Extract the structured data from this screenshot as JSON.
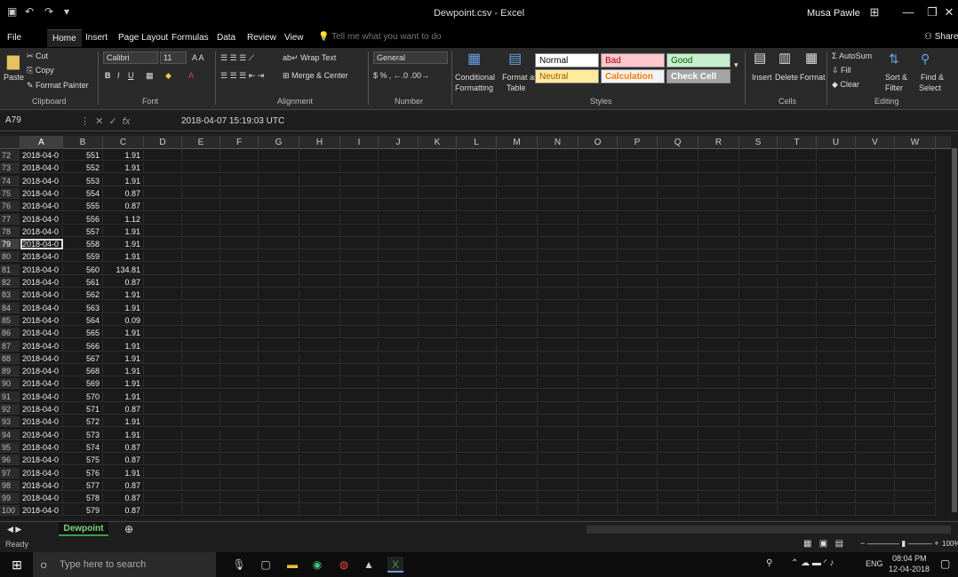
{
  "window": {
    "title": "Dewpoint.csv - Excel",
    "user": "Musa Pawle"
  },
  "tabs": [
    "File",
    "Home",
    "Insert",
    "Page Layout",
    "Formulas",
    "Data",
    "Review",
    "View"
  ],
  "tell_me": "Tell me what you want to do",
  "share": "Share",
  "ribbon": {
    "clipboard": {
      "paste": "Paste",
      "cut": "Cut",
      "copy": "Copy",
      "format_painter": "Format Painter",
      "label": "Clipboard"
    },
    "font": {
      "name": "Calibri",
      "size": "11",
      "label": "Font"
    },
    "alignment": {
      "wrap_text": "Wrap Text",
      "merge_center": "Merge & Center",
      "label": "Alignment"
    },
    "number": {
      "format": "General",
      "label": "Number"
    },
    "styles": {
      "conditional": "Conditional",
      "formatting": "Formatting",
      "format_as": "Format as",
      "table": "Table",
      "normal": "Normal",
      "bad": "Bad",
      "good": "Good",
      "neutral": "Neutral",
      "calculation": "Calculation",
      "check_cell": "Check Cell",
      "label": "Styles"
    },
    "cells": {
      "insert": "Insert",
      "delete": "Delete",
      "format": "Format",
      "label": "Cells"
    },
    "editing": {
      "autosum": "AutoSum",
      "fill": "Fill",
      "clear": "Clear",
      "sort_filter": "Sort &",
      "filter": "Filter",
      "find_select": "Find &",
      "select": "Select",
      "label": "Editing"
    }
  },
  "formula_bar": {
    "name_box": "A79",
    "value": "2018-04-07 15:19:03 UTC"
  },
  "columns": [
    "A",
    "B",
    "C",
    "D",
    "E",
    "F",
    "G",
    "H",
    "I",
    "J",
    "K",
    "L",
    "M",
    "N",
    "O",
    "P",
    "Q",
    "R",
    "S",
    "T",
    "U",
    "V",
    "W"
  ],
  "selected_cell": {
    "row": 79,
    "col": "A"
  },
  "rows": [
    {
      "n": 72,
      "a": "2018-04-0",
      "b": "551",
      "c": "1.91"
    },
    {
      "n": 73,
      "a": "2018-04-0",
      "b": "552",
      "c": "1.91"
    },
    {
      "n": 74,
      "a": "2018-04-0",
      "b": "553",
      "c": "1.91"
    },
    {
      "n": 75,
      "a": "2018-04-0",
      "b": "554",
      "c": "0.87"
    },
    {
      "n": 76,
      "a": "2018-04-0",
      "b": "555",
      "c": "0.87"
    },
    {
      "n": 77,
      "a": "2018-04-0",
      "b": "556",
      "c": "1.12"
    },
    {
      "n": 78,
      "a": "2018-04-0",
      "b": "557",
      "c": "1.91"
    },
    {
      "n": 79,
      "a": "2018-04-0",
      "b": "558",
      "c": "1.91"
    },
    {
      "n": 80,
      "a": "2018-04-0",
      "b": "559",
      "c": "1.91"
    },
    {
      "n": 81,
      "a": "2018-04-0",
      "b": "560",
      "c": "134.81"
    },
    {
      "n": 82,
      "a": "2018-04-0",
      "b": "561",
      "c": "0.87"
    },
    {
      "n": 83,
      "a": "2018-04-0",
      "b": "562",
      "c": "1.91"
    },
    {
      "n": 84,
      "a": "2018-04-0",
      "b": "563",
      "c": "1.91"
    },
    {
      "n": 85,
      "a": "2018-04-0",
      "b": "564",
      "c": "0.09"
    },
    {
      "n": 86,
      "a": "2018-04-0",
      "b": "565",
      "c": "1.91"
    },
    {
      "n": 87,
      "a": "2018-04-0",
      "b": "566",
      "c": "1.91"
    },
    {
      "n": 88,
      "a": "2018-04-0",
      "b": "567",
      "c": "1.91"
    },
    {
      "n": 89,
      "a": "2018-04-0",
      "b": "568",
      "c": "1.91"
    },
    {
      "n": 90,
      "a": "2018-04-0",
      "b": "569",
      "c": "1.91"
    },
    {
      "n": 91,
      "a": "2018-04-0",
      "b": "570",
      "c": "1.91"
    },
    {
      "n": 92,
      "a": "2018-04-0",
      "b": "571",
      "c": "0.87"
    },
    {
      "n": 93,
      "a": "2018-04-0",
      "b": "572",
      "c": "1.91"
    },
    {
      "n": 94,
      "a": "2018-04-0",
      "b": "573",
      "c": "1.91"
    },
    {
      "n": 95,
      "a": "2018-04-0",
      "b": "574",
      "c": "0.87"
    },
    {
      "n": 96,
      "a": "2018-04-0",
      "b": "575",
      "c": "0.87"
    },
    {
      "n": 97,
      "a": "2018-04-0",
      "b": "576",
      "c": "1.91"
    },
    {
      "n": 98,
      "a": "2018-04-0",
      "b": "577",
      "c": "0.87"
    },
    {
      "n": 99,
      "a": "2018-04-0",
      "b": "578",
      "c": "0.87"
    },
    {
      "n": 100,
      "a": "2018-04-0",
      "b": "579",
      "c": "0.87"
    }
  ],
  "sheet_tab": "Dewpoint",
  "status": {
    "ready": "Ready",
    "zoom": "100%"
  },
  "taskbar": {
    "search": "Type here to search",
    "time": "08:04 PM",
    "date": "12-04-2018",
    "lang": "ENG"
  }
}
